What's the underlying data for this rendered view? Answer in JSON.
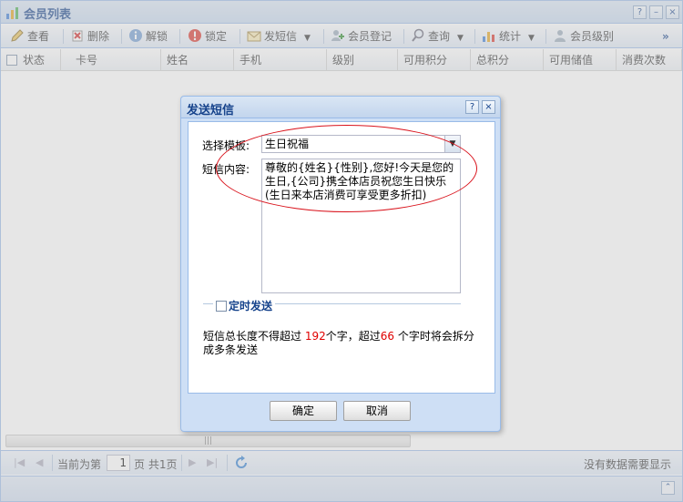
{
  "window": {
    "title": "会员列表"
  },
  "toolbar": {
    "view": "查看",
    "delete": "删除",
    "unlock": "解锁",
    "lock": "锁定",
    "sms": "发短信",
    "register": "会员登记",
    "query": "查询",
    "stats": "统计",
    "level": "会员级别",
    "more": "»"
  },
  "grid": {
    "columns": [
      "状态",
      "卡号",
      "姓名",
      "手机",
      "级别",
      "可用积分",
      "总积分",
      "可用储值",
      "消费次数"
    ]
  },
  "pager": {
    "current_prefix": "当前为第",
    "page_value": "1",
    "page_suffix": "页 共1页",
    "empty_message": "没有数据需要显示"
  },
  "dialog": {
    "title": "发送短信",
    "template_label": "选择模板:",
    "template_value": "生日祝福",
    "content_label": "短信内容:",
    "content_value": "尊敬的{姓名}{性别},您好!今天是您的生日,{公司}携全体店员祝您生日快乐(生日来本店消费可享受更多折扣)",
    "scheduled_label": "定时发送",
    "info_prefix": "短信总长度不得超过 ",
    "info_max": "192",
    "info_middle": "个字，超过",
    "info_split": "66",
    "info_suffix": " 个字时将会拆分成多条发送",
    "ok": "确定",
    "cancel": "取消"
  },
  "colors": {
    "title_text": "#15428b",
    "highlight": "#e00000",
    "annotation": "#d9121b",
    "border": "#99bbe8"
  }
}
